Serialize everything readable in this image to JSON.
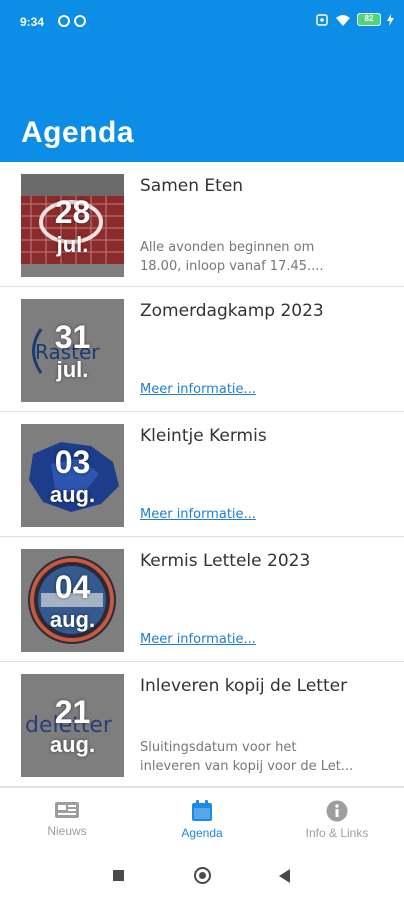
{
  "status_bar": {
    "time": "9:34",
    "battery": "82"
  },
  "header": {
    "title": "Agenda"
  },
  "events": [
    {
      "day": "28",
      "month": "jul.",
      "title": "Samen Eten",
      "desc_line1": "Alle avonden beginnen om",
      "desc_line2": "18.00, inloop vanaf 17.45....",
      "link": ""
    },
    {
      "day": "31",
      "month": "jul.",
      "title": "Zomerdagkamp 2023",
      "link": "Meer informatie..."
    },
    {
      "day": "03",
      "month": "aug.",
      "title": "Kleintje Kermis",
      "link": "Meer informatie..."
    },
    {
      "day": "04",
      "month": "aug.",
      "title": "Kermis Lettele 2023",
      "link": "Meer informatie..."
    },
    {
      "day": "21",
      "month": "aug.",
      "title": "Inleveren kopij de Letter",
      "desc_line1": "Sluitingsdatum voor het",
      "desc_line2": "inleveren van kopij voor de Let...",
      "link": ""
    }
  ],
  "thumb_logos": {
    "raster": "Raster",
    "deletter": "deletter"
  },
  "bottom_nav": {
    "items": [
      {
        "label": "Nieuws",
        "icon": "newspaper-icon"
      },
      {
        "label": "Agenda",
        "icon": "calendar-icon",
        "active": true
      },
      {
        "label": "Info & Links",
        "icon": "info-icon"
      }
    ]
  },
  "colors": {
    "header_bg": "#0c8de6",
    "active": "#1e88e5",
    "link": "#1e7ed6"
  }
}
